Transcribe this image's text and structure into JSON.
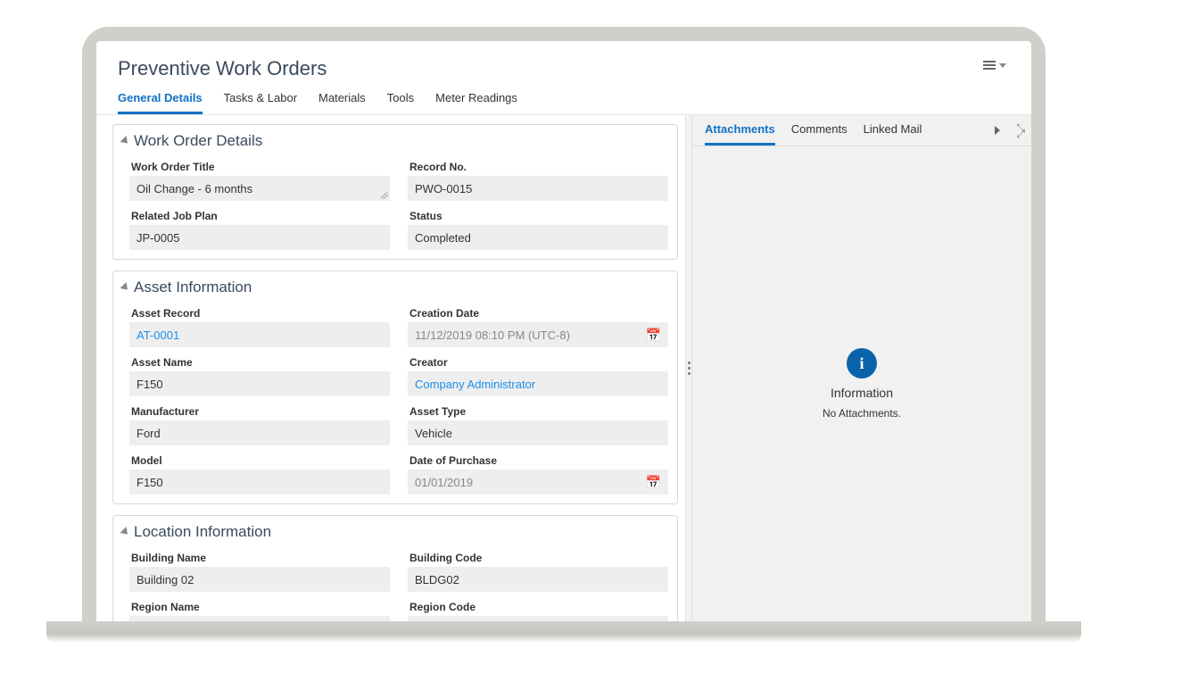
{
  "page_title": "Preventive Work Orders",
  "main_tabs": [
    "General Details",
    "Tasks & Labor",
    "Materials",
    "Tools",
    "Meter Readings"
  ],
  "active_main_tab": 0,
  "right_panel": {
    "tabs": [
      "Attachments",
      "Comments",
      "Linked Mail"
    ],
    "active_tab": 0,
    "info_heading": "Information",
    "info_message": "No Attachments."
  },
  "sections": {
    "work_order": {
      "title": "Work Order Details",
      "fields": {
        "work_order_title": {
          "label": "Work Order Title",
          "value": "Oil Change - 6 months"
        },
        "record_no": {
          "label": "Record No.",
          "value": "PWO-0015"
        },
        "related_job_plan": {
          "label": "Related Job Plan",
          "value": "JP-0005"
        },
        "status": {
          "label": "Status",
          "value": "Completed"
        }
      }
    },
    "asset_info": {
      "title": "Asset Information",
      "fields": {
        "asset_record": {
          "label": "Asset Record",
          "value": "AT-0001"
        },
        "creation_date": {
          "label": "Creation Date",
          "value": "11/12/2019 08:10 PM  (UTC-8)"
        },
        "asset_name": {
          "label": "Asset Name",
          "value": "F150"
        },
        "creator": {
          "label": "Creator",
          "value": "Company Administrator"
        },
        "manufacturer": {
          "label": "Manufacturer",
          "value": "Ford"
        },
        "asset_type": {
          "label": "Asset Type",
          "value": "Vehicle"
        },
        "model": {
          "label": "Model",
          "value": "F150"
        },
        "date_of_purchase": {
          "label": "Date of Purchase",
          "value": "01/01/2019"
        }
      }
    },
    "location_info": {
      "title": "Location Information",
      "fields": {
        "building_name": {
          "label": "Building Name",
          "value": "Building 02"
        },
        "building_code": {
          "label": "Building Code",
          "value": "BLDG02"
        },
        "region_name": {
          "label": "Region Name",
          "value": ""
        },
        "region_code": {
          "label": "Region Code",
          "value": ""
        }
      }
    }
  }
}
